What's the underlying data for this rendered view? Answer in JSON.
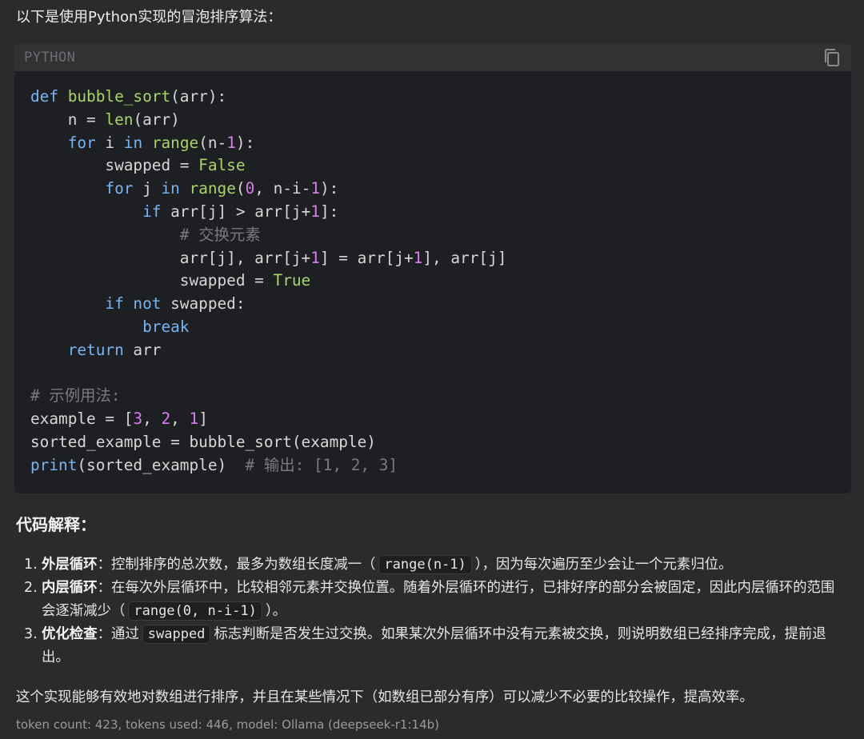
{
  "intro": "以下是使用Python实现的冒泡排序算法：",
  "code_block": {
    "language": "PYTHON",
    "copy_icon": "copy-icon",
    "lines": [
      [
        {
          "t": "kw",
          "v": "def "
        },
        {
          "t": "fn",
          "v": "bubble_sort"
        },
        {
          "t": "plain",
          "v": "(arr):"
        }
      ],
      [
        {
          "t": "plain",
          "v": "    n = "
        },
        {
          "t": "fn",
          "v": "len"
        },
        {
          "t": "plain",
          "v": "(arr)"
        }
      ],
      [
        {
          "t": "plain",
          "v": "    "
        },
        {
          "t": "kw",
          "v": "for"
        },
        {
          "t": "plain",
          "v": " i "
        },
        {
          "t": "kw",
          "v": "in"
        },
        {
          "t": "plain",
          "v": " "
        },
        {
          "t": "fn",
          "v": "range"
        },
        {
          "t": "plain",
          "v": "(n-"
        },
        {
          "t": "num",
          "v": "1"
        },
        {
          "t": "plain",
          "v": "):"
        }
      ],
      [
        {
          "t": "plain",
          "v": "        swapped = "
        },
        {
          "t": "bool",
          "v": "False"
        }
      ],
      [
        {
          "t": "plain",
          "v": "        "
        },
        {
          "t": "kw",
          "v": "for"
        },
        {
          "t": "plain",
          "v": " j "
        },
        {
          "t": "kw",
          "v": "in"
        },
        {
          "t": "plain",
          "v": " "
        },
        {
          "t": "fn",
          "v": "range"
        },
        {
          "t": "plain",
          "v": "("
        },
        {
          "t": "num",
          "v": "0"
        },
        {
          "t": "plain",
          "v": ", n-i-"
        },
        {
          "t": "num",
          "v": "1"
        },
        {
          "t": "plain",
          "v": "):"
        }
      ],
      [
        {
          "t": "plain",
          "v": "            "
        },
        {
          "t": "kw",
          "v": "if"
        },
        {
          "t": "plain",
          "v": " arr[j] > arr[j+"
        },
        {
          "t": "num",
          "v": "1"
        },
        {
          "t": "plain",
          "v": "]:"
        }
      ],
      [
        {
          "t": "plain",
          "v": "                "
        },
        {
          "t": "cm",
          "v": "# 交换元素"
        }
      ],
      [
        {
          "t": "plain",
          "v": "                arr[j], arr[j+"
        },
        {
          "t": "num",
          "v": "1"
        },
        {
          "t": "plain",
          "v": "] = arr[j+"
        },
        {
          "t": "num",
          "v": "1"
        },
        {
          "t": "plain",
          "v": "], arr[j]"
        }
      ],
      [
        {
          "t": "plain",
          "v": "                swapped = "
        },
        {
          "t": "bool",
          "v": "True"
        }
      ],
      [
        {
          "t": "plain",
          "v": "        "
        },
        {
          "t": "kw",
          "v": "if not"
        },
        {
          "t": "plain",
          "v": " swapped:"
        }
      ],
      [
        {
          "t": "plain",
          "v": "            "
        },
        {
          "t": "kw",
          "v": "break"
        }
      ],
      [
        {
          "t": "plain",
          "v": "    "
        },
        {
          "t": "kw",
          "v": "return"
        },
        {
          "t": "plain",
          "v": " arr"
        }
      ],
      [],
      [
        {
          "t": "cm",
          "v": "# 示例用法:"
        }
      ],
      [
        {
          "t": "plain",
          "v": "example = ["
        },
        {
          "t": "num",
          "v": "3"
        },
        {
          "t": "plain",
          "v": ", "
        },
        {
          "t": "num",
          "v": "2"
        },
        {
          "t": "plain",
          "v": ", "
        },
        {
          "t": "num",
          "v": "1"
        },
        {
          "t": "plain",
          "v": "]"
        }
      ],
      [
        {
          "t": "plain",
          "v": "sorted_example = bubble_sort(example)"
        }
      ],
      [
        {
          "t": "kw",
          "v": "print"
        },
        {
          "t": "plain",
          "v": "(sorted_example)  "
        },
        {
          "t": "cm",
          "v": "# 输出: [1, 2, 3]"
        }
      ]
    ]
  },
  "section_title": "代码解释：",
  "explanations": [
    {
      "num": "1.",
      "title": "外层循环",
      "parts": [
        {
          "type": "text",
          "v": "：控制排序的总次数，最多为数组长度减一（"
        },
        {
          "type": "code",
          "v": "range(n-1)"
        },
        {
          "type": "text",
          "v": "），因为每次遍历至少会让一个元素归位。"
        }
      ]
    },
    {
      "num": "2.",
      "title": "内层循环",
      "parts": [
        {
          "type": "text",
          "v": "：在每次外层循环中，比较相邻元素并交换位置。随着外层循环的进行，已排好序的部分会被固定，因此内层循环的范围会逐渐减少（"
        },
        {
          "type": "code",
          "v": "range(0, n-i-1)"
        },
        {
          "type": "text",
          "v": "）。"
        }
      ]
    },
    {
      "num": "3.",
      "title": "优化检查",
      "parts": [
        {
          "type": "text",
          "v": "：通过"
        },
        {
          "type": "code",
          "v": "swapped"
        },
        {
          "type": "text",
          "v": "标志判断是否发生过交换。如果某次外层循环中没有元素被交换，则说明数组已经排序完成，提前退出。"
        }
      ]
    }
  ],
  "summary": "这个实现能够有效地对数组进行排序，并且在某些情况下（如数组已部分有序）可以减少不必要的比较操作，提高效率。",
  "meta": "token count: 423, tokens used: 446, model: Ollama (deepseek-r1:14b)"
}
